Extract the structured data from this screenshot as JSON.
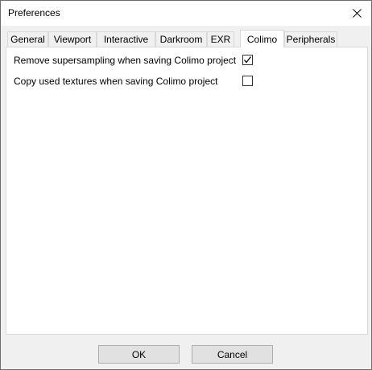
{
  "window": {
    "title": "Preferences",
    "close_icon": "close-icon"
  },
  "tabs": [
    {
      "label": "General"
    },
    {
      "label": "Viewport"
    },
    {
      "label": "Interactive"
    },
    {
      "label": "Darkroom"
    },
    {
      "label": "EXR"
    },
    {
      "label": "Colimo",
      "active": true
    },
    {
      "label": "Peripherals"
    }
  ],
  "options": [
    {
      "label": "Remove supersampling when saving Colimo project",
      "checked": true
    },
    {
      "label": "Copy used textures when saving Colimo project",
      "checked": false
    }
  ],
  "buttons": {
    "ok": "OK",
    "cancel": "Cancel"
  }
}
